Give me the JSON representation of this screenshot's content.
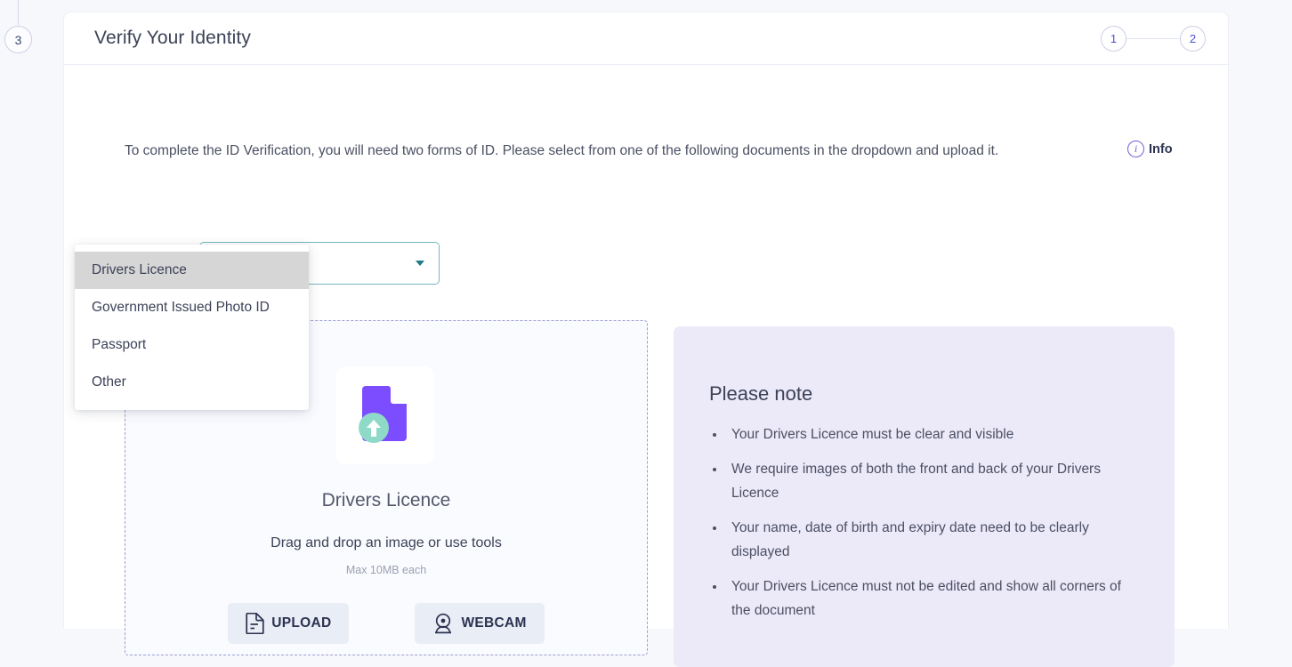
{
  "stepper": {
    "side_step_label": "3",
    "progress": [
      {
        "label": "1"
      },
      {
        "label": "2"
      }
    ]
  },
  "header": {
    "title": "Verify Your Identity"
  },
  "instruction": {
    "text": "To complete the ID Verification, you will need two forms of ID. Please select from one of the following documents in the dropdown and upload it.",
    "info_label": "Info",
    "info_glyph": "i"
  },
  "select": {
    "value": "",
    "placeholder": "",
    "options": [
      {
        "label": "Drivers Licence",
        "highlighted": true
      },
      {
        "label": "Government Issued Photo ID",
        "highlighted": false
      },
      {
        "label": "Passport",
        "highlighted": false
      },
      {
        "label": "Other",
        "highlighted": false
      }
    ]
  },
  "dropzone": {
    "title": "Drivers Licence",
    "subtitle": "Drag and drop an image or use tools",
    "max_size": "Max 10MB each",
    "upload_button": "UPLOAD",
    "webcam_button": "WEBCAM"
  },
  "please_note": {
    "title": "Please note",
    "items": [
      "Your Drivers Licence must be clear and visible",
      "We require images of both the front and back of your Drivers Licence",
      "Your name, date of birth and expiry date need to be clearly displayed",
      "Your Drivers Licence must not be edited and show all corners of the document"
    ]
  },
  "colors": {
    "page_background": "#f7f8fb",
    "card_background": "#ffffff",
    "accent_purple": "#6e5fd6",
    "accent_teal": "#79b7bd",
    "note_panel_background": "#ece9f9",
    "dashed_border": "#9a9ed4",
    "button_background": "#e9edf6",
    "text_primary": "#3c4257",
    "highlight_option": "#d6d6d6"
  }
}
